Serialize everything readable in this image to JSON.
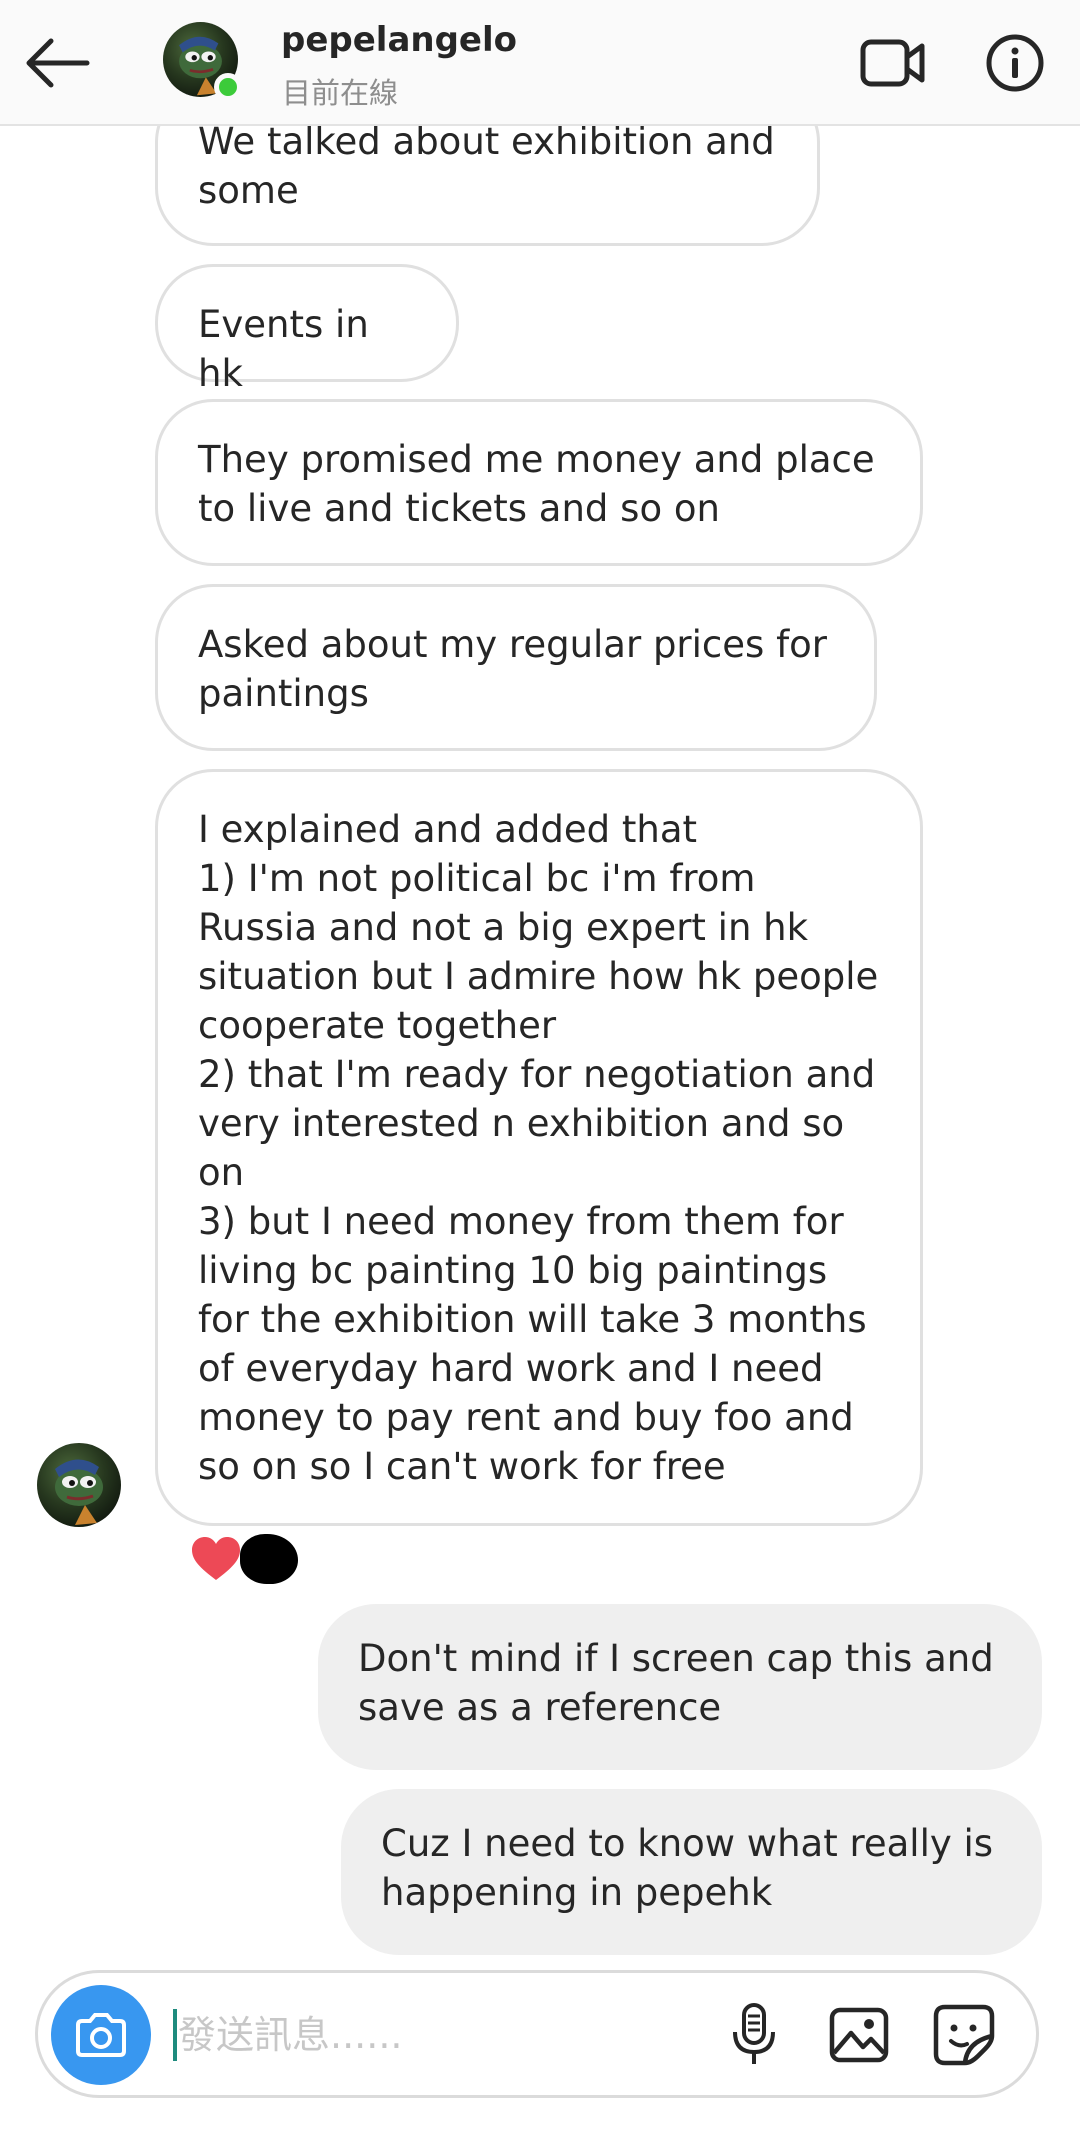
{
  "header": {
    "username": "pepelangelo",
    "status": "目前在線"
  },
  "messages": [
    {
      "direction": "in",
      "text": "We talked about exhibition and\nsome"
    },
    {
      "direction": "in",
      "text": "Events in hk"
    },
    {
      "direction": "in",
      "text": "They promised me money and place\nto live and tickets and so on"
    },
    {
      "direction": "in",
      "text": "Asked about my regular prices for\npaintings"
    },
    {
      "direction": "in",
      "text": "I explained and added that\n1) I'm not political bc i'm from\nRussia and not a big expert in hk\nsituation but I admire how hk people\ncooperate together\n2) that I'm ready for negotiation and\nvery interested n exhibition and so\non\n3) but I need money from them for\nliving bc painting 10 big paintings\nfor the exhibition will take 3 months\nof everyday hard work and I need\nmoney to pay rent and buy foo and\nso on so I can't work for free"
    },
    {
      "direction": "out",
      "text": "Don't mind if I screen cap this and\nsave as a reference"
    },
    {
      "direction": "out",
      "text": "Cuz I need to know what really is\nhappening in pepehk"
    }
  ],
  "reactions": [
    "heart",
    "redacted"
  ],
  "composer": {
    "placeholder": "發送訊息......"
  },
  "colors": {
    "accent_blue": "#3897f0",
    "online_green": "#3ccb3a",
    "heart_red": "#ed4956",
    "outgoing_bubble": "#efefef"
  },
  "icons": [
    "back-arrow-icon",
    "video-camera-icon",
    "info-icon",
    "camera-icon",
    "microphone-icon",
    "gallery-icon",
    "sticker-icon",
    "heart-icon"
  ]
}
